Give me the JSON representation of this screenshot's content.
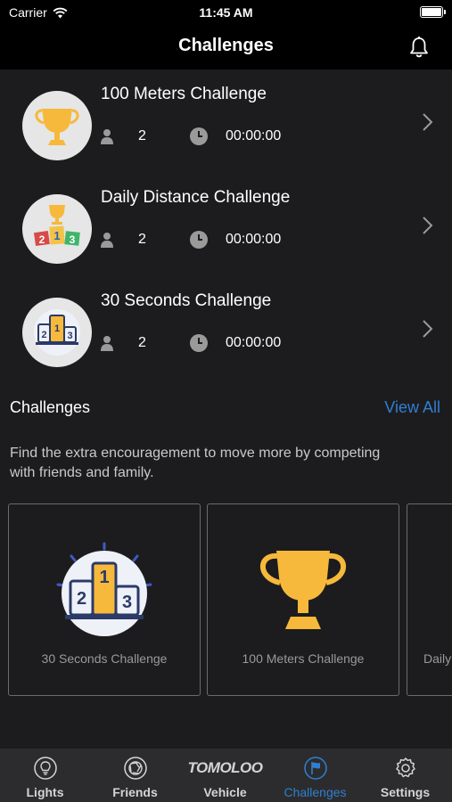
{
  "status_bar": {
    "carrier": "Carrier",
    "time": "11:45 AM"
  },
  "nav": {
    "title": "Challenges"
  },
  "challenge_list": [
    {
      "title": "100 Meters Challenge",
      "participants": "2",
      "time": "00:00:00",
      "icon": "trophy-icon"
    },
    {
      "title": "Daily Distance Challenge",
      "participants": "2",
      "time": "00:00:00",
      "icon": "podium-blocks-icon"
    },
    {
      "title": "30 Seconds Challenge",
      "participants": "2",
      "time": "00:00:00",
      "icon": "podium-icon"
    }
  ],
  "section": {
    "heading": "Challenges",
    "view_all": "View All",
    "description": "Find the extra encouragement to move more by competing with friends and family."
  },
  "cards": [
    {
      "label": "30 Seconds Challenge",
      "icon": "podium-icon"
    },
    {
      "label": "100 Meters Challenge",
      "icon": "trophy-icon"
    },
    {
      "label": "Daily",
      "icon": "podium-blocks-icon"
    }
  ],
  "tabs": [
    {
      "label": "Lights",
      "icon": "bulb-icon",
      "active": false
    },
    {
      "label": "Friends",
      "icon": "aperture-icon",
      "active": false
    },
    {
      "label": "Vehicle",
      "icon": "brand-logo",
      "brand": "TOMOLOO",
      "active": false
    },
    {
      "label": "Challenges",
      "icon": "flag-icon",
      "active": true
    },
    {
      "label": "Settings",
      "icon": "gear-icon",
      "active": false
    }
  ],
  "colors": {
    "accent": "#2f7fd1",
    "gold": "#f6b93b",
    "background": "#1c1c1e",
    "bar": "#2c2c2e"
  }
}
